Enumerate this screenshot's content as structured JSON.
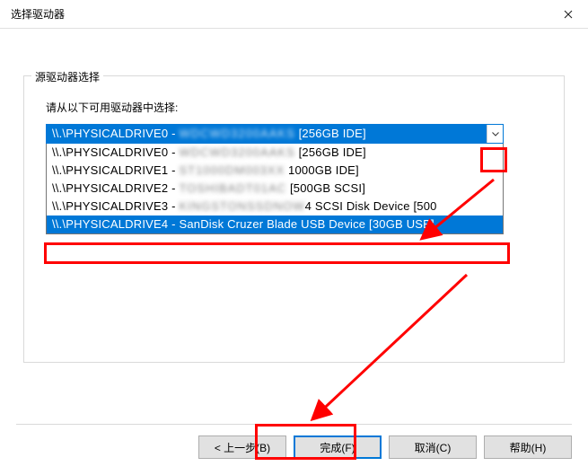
{
  "titlebar": {
    "title": "选择驱动器"
  },
  "group": {
    "legend": "源驱动器选择",
    "instruction": "请从以下可用驱动器中选择:"
  },
  "combo": {
    "prefix": "\\\\.\\PHYSICALDRIVE0 - ",
    "blur": "WDCWD3200AAKS",
    "suffix": " [256GB IDE]"
  },
  "dropdown": [
    {
      "prefix": "\\\\.\\PHYSICALDRIVE0 - ",
      "blur": "WDCWD3200AAKS",
      "suffix": " [256GB IDE]",
      "selected": false
    },
    {
      "prefix": "\\\\.\\PHYSICALDRIVE1 - ",
      "blur": "ST1000DM003XX",
      "suffix": " 1000GB IDE]",
      "selected": false
    },
    {
      "prefix": "\\\\.\\PHYSICALDRIVE2 - ",
      "blur": "TOSHIBADT01AC",
      "suffix": " [500GB SCSI]",
      "selected": false
    },
    {
      "prefix": "\\\\.\\PHYSICALDRIVE3 - ",
      "blur": "KINGSTONSSDNOW",
      "suffix": "4 SCSI Disk Device [500",
      "selected": false
    },
    {
      "prefix": "\\\\.\\PHYSICALDRIVE4 - SanDisk Cruzer Blade USB Device [30GB USB]",
      "blur": "",
      "suffix": "",
      "selected": true
    }
  ],
  "buttons": {
    "back": "< 上一步(B)",
    "finish": "完成(F)",
    "cancel": "取消(C)",
    "help": "帮助(H)"
  },
  "colors": {
    "accent": "#0078d7",
    "highlight": "#ff0000"
  }
}
